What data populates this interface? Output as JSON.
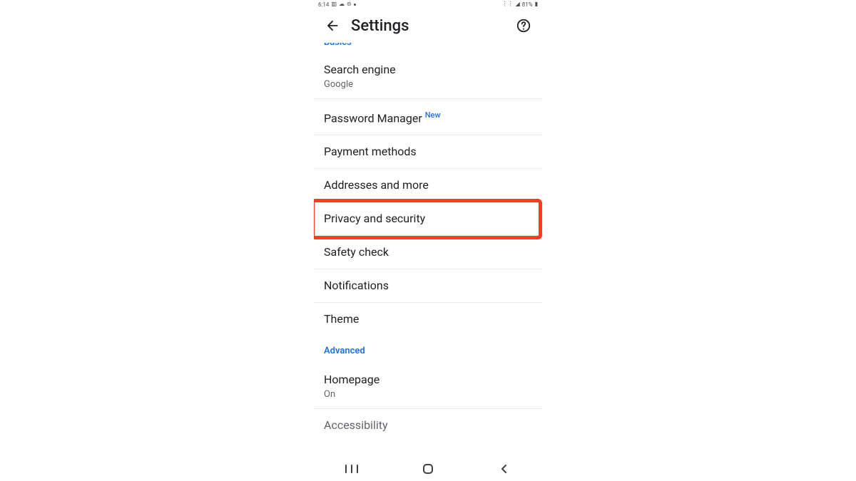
{
  "statusbar": {
    "time": "6:14",
    "battery_text": "81%"
  },
  "appbar": {
    "title": "Settings"
  },
  "sections": {
    "basics_label": "Basics",
    "advanced_label": "Advanced"
  },
  "rows": {
    "search_engine": {
      "label": "Search engine",
      "value": "Google"
    },
    "password_manager": {
      "label": "Password Manager",
      "badge": "New"
    },
    "payment_methods": {
      "label": "Payment methods"
    },
    "addresses": {
      "label": "Addresses and more"
    },
    "privacy": {
      "label": "Privacy and security"
    },
    "safety_check": {
      "label": "Safety check"
    },
    "notifications": {
      "label": "Notifications"
    },
    "theme": {
      "label": "Theme"
    },
    "homepage": {
      "label": "Homepage",
      "value": "On"
    },
    "accessibility": {
      "label": "Accessibility"
    }
  }
}
